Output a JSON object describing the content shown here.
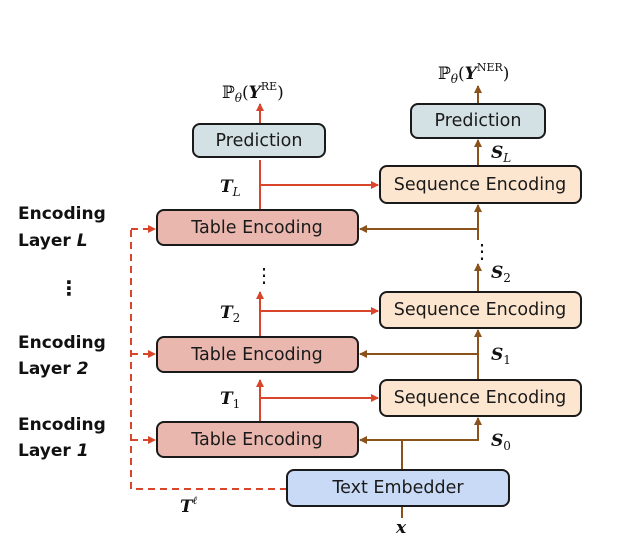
{
  "boxes": {
    "prediction_re": "Prediction",
    "prediction_ner": "Prediction",
    "sequence_encoding_l": "Sequence Encoding",
    "sequence_encoding_2": "Sequence Encoding",
    "sequence_encoding_1": "Sequence Encoding",
    "table_encoding_l": "Table Encoding",
    "table_encoding_2": "Table Encoding",
    "table_encoding_1": "Table Encoding",
    "text_embedder": "Text Embedder"
  },
  "layers": [
    {
      "word": "Encoding",
      "prefix": "Layer ",
      "index": "L"
    },
    {
      "word": "Encoding",
      "prefix": "Layer ",
      "index": "2"
    },
    {
      "word": "Encoding",
      "prefix": "Layer ",
      "index": "1"
    }
  ],
  "ellipsis": "⋮",
  "math": {
    "p_re": {
      "p": "ℙ",
      "sub": "θ",
      "open": "(",
      "y": "Y",
      "sup": "RE",
      "close": ")"
    },
    "p_ner": {
      "p": "ℙ",
      "sub": "θ",
      "open": "(",
      "y": "Y",
      "sup": "NER",
      "close": ")"
    },
    "t_l": {
      "base": "T",
      "sub": "L"
    },
    "t_2": {
      "base": "T",
      "sub": "2"
    },
    "t_1": {
      "base": "T",
      "sub": "1"
    },
    "s_l": {
      "base": "S",
      "sub": "L"
    },
    "s_2": {
      "base": "S",
      "sub": "2"
    },
    "s_1": {
      "base": "S",
      "sub": "1"
    },
    "s_0": {
      "base": "S",
      "sub": "0"
    },
    "t_ell": {
      "base": "T",
      "sup": "ℓ"
    },
    "x": "x"
  },
  "colors": {
    "prediction": "#d3e0e4",
    "sequence": "#fde6cf",
    "table": "#e9b7ae",
    "embedder": "#c9daf6",
    "red_arrow": "#d9452b",
    "brown_arrow": "#8a531c"
  }
}
